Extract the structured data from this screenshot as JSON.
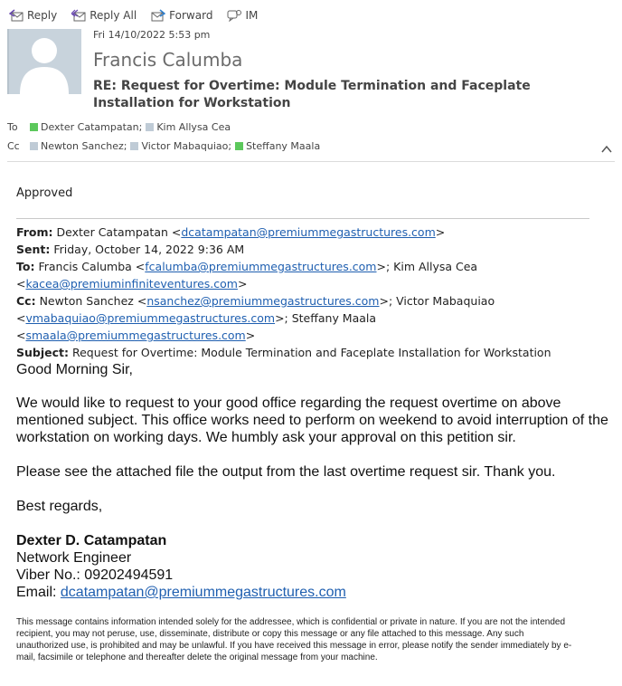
{
  "toolbar": {
    "reply": "Reply",
    "reply_all": "Reply All",
    "forward": "Forward",
    "im": "IM"
  },
  "header": {
    "date": "Fri 14/10/2022 5:53 pm",
    "sender": "Francis Calumba",
    "subject": "RE: Request for Overtime: Module Termination and Faceplate Installation for Workstation",
    "to_label": "To",
    "cc_label": "Cc",
    "to": [
      {
        "name": "Dexter Catampatan;",
        "status_color": "#5cc85c"
      },
      {
        "name": "Kim Allysa Cea",
        "status_color": "#bfcbd6"
      }
    ],
    "cc": [
      {
        "name": "Newton Sanchez;",
        "status_color": "#bfcbd6"
      },
      {
        "name": "Victor Mabaquiao;",
        "status_color": "#bfcbd6"
      },
      {
        "name": "Steffany Maala",
        "status_color": "#5cc85c"
      }
    ]
  },
  "reply_text": "Approved",
  "original": {
    "from_label": "From:",
    "from_name": "Dexter Catampatan <",
    "from_email": "dcatampatan@premiummegastructures.com",
    "from_close": ">",
    "sent_label": "Sent:",
    "sent": "Friday, October 14, 2022 9:36 AM",
    "to_label": "To:",
    "to_1_name": "Francis Calumba <",
    "to_1_email": "fcalumba@premiummegastructures.com",
    "to_1_close": ">; Kim Allysa Cea",
    "to_2_open": "<",
    "to_2_email": "kacea@premiuminfiniteventures.com",
    "to_2_close": ">",
    "cc_label": "Cc:",
    "cc_1_name": "Newton Sanchez <",
    "cc_1_email": "nsanchez@premiummegastructures.com",
    "cc_1_close": ">; Victor Mabaquiao",
    "cc_2_open": "<",
    "cc_2_email": "vmabaquiao@premiummegastructures.com",
    "cc_2_close": ">; Steffany Maala <",
    "cc_3_email": "smaala@premiummegastructures.com",
    "cc_3_close": ">",
    "subject_label": "Subject:",
    "subject": "Request for Overtime: Module Termination and Faceplate Installation for Workstation"
  },
  "message": {
    "greeting": "Good Morning Sir,",
    "para1": "We would like to request to your good office regarding the request overtime on above mentioned subject. This office works need to perform on weekend to avoid interruption of the workstation on working days. We humbly ask your approval on this petition sir.",
    "para2": "Please see the attached file the output from the last overtime request sir. Thank you.",
    "closing": "Best regards,",
    "sig_name": "Dexter D. Catampatan",
    "sig_title": "Network Engineer",
    "sig_viber": "Viber No.: 09202494591",
    "sig_email_label": "Email: ",
    "sig_email": "dcatampatan@premiummegastructures.com"
  },
  "disclaimer": "This message contains information intended solely for the addressee, which is confidential or private in nature. If you are not the intended recipient, you may not peruse, use, disseminate, distribute or copy this message or any file attached to this message. Any such unauthorized use, is prohibited and may be unlawful. If you have received this message in error, please notify the sender immediately by e-mail, facsimile or telephone and thereafter delete the original message from your machine.",
  "colors": {
    "link": "#1f5fb0",
    "presence_online": "#5cc85c",
    "presence_unknown": "#bfcbd6"
  }
}
